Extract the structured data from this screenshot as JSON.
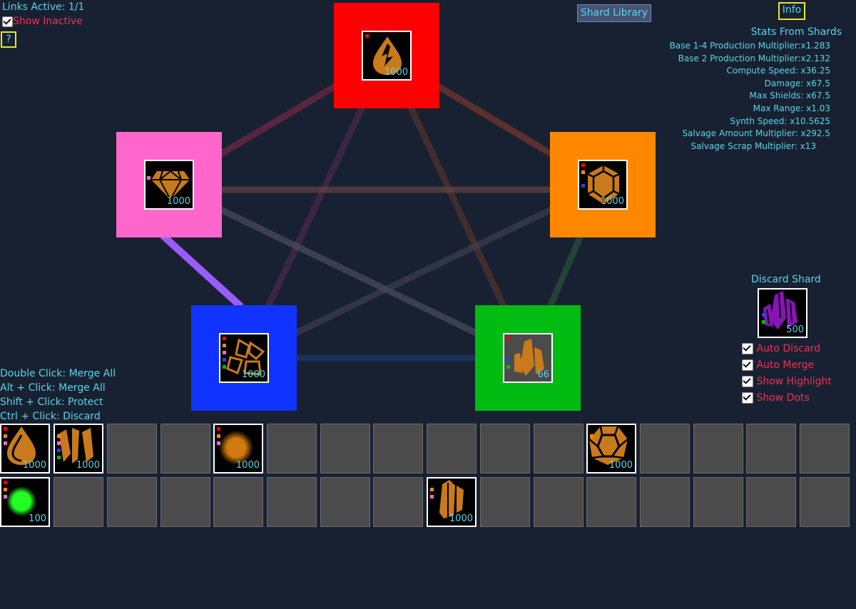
{
  "hud": {
    "links_active": "Links Active: 1/1",
    "show_inactive": "Show Inactive",
    "help": "?",
    "shard_library": "Shard Library",
    "info": "Info"
  },
  "stats": {
    "title": "Stats From Shards",
    "rows": [
      "Base 1-4 Production Multiplier:x1.283",
      "Base 2 Production Multiplier:x2.132",
      "Compute Speed: x36.25",
      "Damage: x67.5",
      "Max Shields: x67.5",
      "Max Range: x1.03",
      "Synth Speed: x10.5625",
      "Salvage Amount Multiplier: x292.5",
      "Salvage Scrap Multiplier: x13"
    ]
  },
  "nodes": {
    "red": {
      "qty": "1000",
      "color": "#ff0000",
      "icon": "drop-shard-icon"
    },
    "orange": {
      "qty": "1000",
      "color": "#ff8800",
      "icon": "hexagon-gem-icon"
    },
    "pink": {
      "qty": "1000",
      "color": "#ff66cc",
      "icon": "diamond-icon"
    },
    "blue": {
      "qty": "1000",
      "color": "#1133ff",
      "icon": "fragmented-gem-icon"
    },
    "green": {
      "qty": "66",
      "color": "#00bb11",
      "icon": "crystal-cluster-icon"
    }
  },
  "discard": {
    "title": "Discard Shard",
    "qty": "500",
    "toggles": [
      "Auto Discard",
      "Auto Merge",
      "Show Highlight",
      "Show Dots"
    ]
  },
  "controls": [
    "Double Click: Merge All",
    "Alt + Click: Merge All",
    "Shift + Click: Protect",
    "Ctrl + Click: Discard"
  ],
  "inventory": {
    "row1": {
      "c0": "1000",
      "c1": "1000",
      "c4": "1000",
      "c11": "1000"
    },
    "row2": {
      "c0": "100",
      "c8": "1000"
    }
  }
}
